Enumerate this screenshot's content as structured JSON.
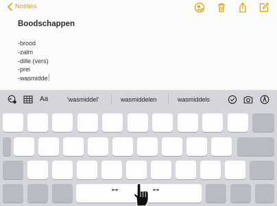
{
  "nav": {
    "back_label": "Notities",
    "accent_color": "#e0a100",
    "tools": [
      "add-person-icon",
      "trash-icon",
      "share-icon",
      "compose-icon"
    ]
  },
  "note": {
    "title": "Boodschappen",
    "lines": [
      "-brood",
      "-zalm",
      "-dille (vers)",
      "-prei",
      "-wasmidde"
    ]
  },
  "keyboard": {
    "format_label": "Aa",
    "suggestions": [
      "'wasmiddel'",
      "wasmiddelen",
      "wasmiddels"
    ],
    "cursor_arrows": [
      "↔",
      "↔"
    ]
  }
}
